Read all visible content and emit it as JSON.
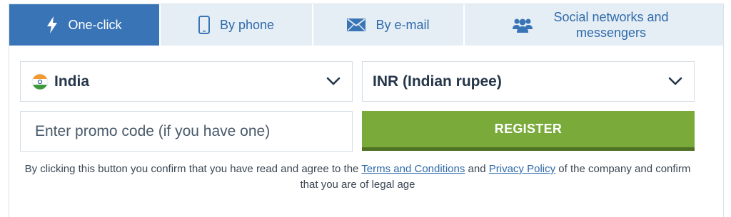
{
  "tabs": [
    {
      "label": "One-click",
      "icon": "lightning-icon",
      "active": true
    },
    {
      "label": "By phone",
      "icon": "phone-icon",
      "active": false
    },
    {
      "label": "By e-mail",
      "icon": "envelope-icon",
      "active": false
    },
    {
      "label": "Social networks and messengers",
      "icon": "users-icon",
      "active": false
    }
  ],
  "form": {
    "country": {
      "value": "India",
      "icon": "india-flag-icon"
    },
    "currency": {
      "value": "INR (Indian rupee)"
    },
    "promo": {
      "placeholder": "Enter promo code (if you have one)"
    },
    "register_label": "REGISTER"
  },
  "notice": {
    "text_before": "By clicking this button you confirm that you have read and agree to the",
    "terms_link": "Terms and Conditions",
    "and_text": "and",
    "privacy_link": "Privacy Policy",
    "text_after": "of the company and confirm that you are of legal age"
  },
  "colors": {
    "tab_active": "#3975b6",
    "tab_inactive": "#e6eef5",
    "register": "#7aab3a",
    "link": "#2f6aaa"
  }
}
